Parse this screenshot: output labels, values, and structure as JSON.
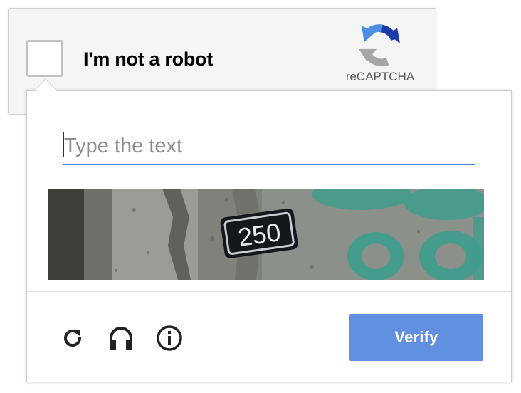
{
  "anchor": {
    "checkbox_label": "I'm not a robot",
    "brand": "reCAPTCHA"
  },
  "challenge": {
    "input_placeholder": "Type the text",
    "input_value": "",
    "image_text": "250",
    "verify_label": "Verify",
    "tools": [
      "refresh-icon",
      "headphones-icon",
      "info-icon"
    ]
  },
  "colors": {
    "accent": "#4a7bd8",
    "verify_bg": "#6190e0",
    "logo_blue": "#1c3aa9",
    "logo_light_blue": "#4a90e2",
    "logo_gray": "#a6a6a6"
  }
}
